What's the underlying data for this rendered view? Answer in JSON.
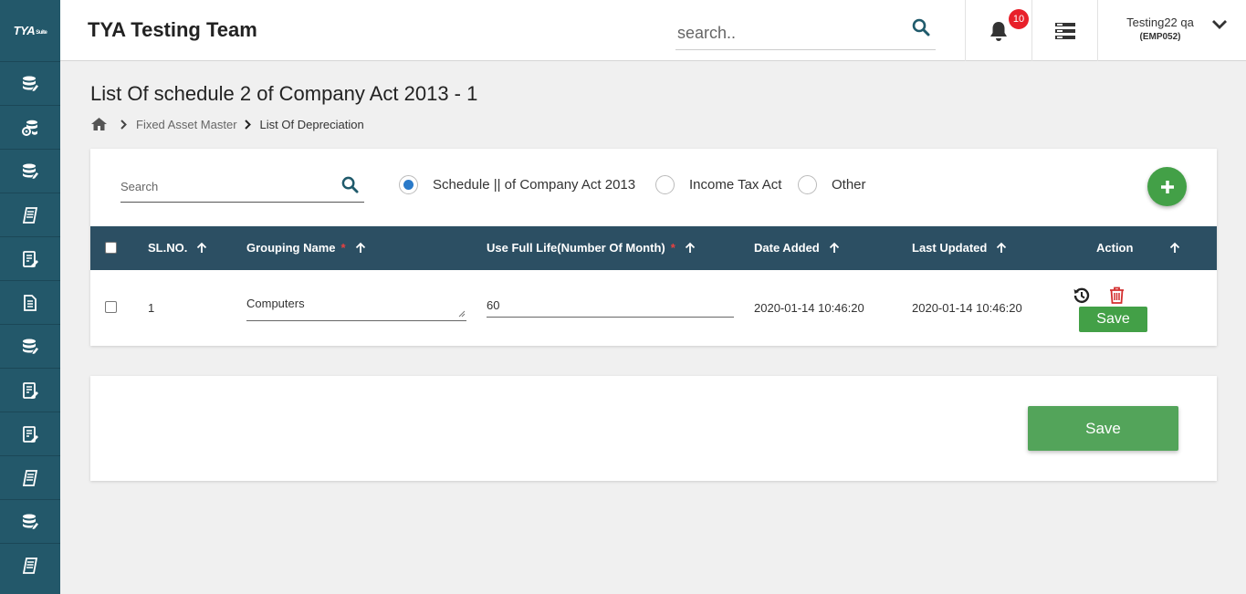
{
  "brand": {
    "logo_text": "TYA",
    "logo_sub": "Suite"
  },
  "header": {
    "title": "TYA Testing Team",
    "search_placeholder": "search..",
    "notification_count": "10",
    "user_name": "Testing22 qa",
    "user_code": "(EMP052)"
  },
  "sidebar": {
    "items": [
      {
        "icon": "database-icon"
      },
      {
        "icon": "gear-database-icon"
      },
      {
        "icon": "database-icon"
      },
      {
        "icon": "ledger-icon"
      },
      {
        "icon": "edit-document-icon"
      },
      {
        "icon": "document-icon"
      },
      {
        "icon": "database-icon"
      },
      {
        "icon": "edit-document-icon"
      },
      {
        "icon": "edit-document-icon"
      },
      {
        "icon": "ledger-icon"
      },
      {
        "icon": "database-icon"
      },
      {
        "icon": "ledger-icon"
      }
    ]
  },
  "page": {
    "title": "List Of schedule 2 of Company Act 2013 - 1",
    "breadcrumb": [
      "Fixed Asset Master",
      "List Of Depreciation"
    ]
  },
  "filters": {
    "search_placeholder": "Search",
    "radios": [
      {
        "label": "Schedule || of Company Act 2013",
        "selected": true
      },
      {
        "label": "Income Tax Act",
        "selected": false
      },
      {
        "label": "Other",
        "selected": false
      }
    ]
  },
  "table": {
    "columns": {
      "sl_no": "SL.NO.",
      "grouping_name": "Grouping Name",
      "useful_life": "Use Full Life(Number Of Month)",
      "date_added": "Date Added",
      "last_updated": "Last Updated",
      "action": "Action"
    },
    "required_mark": "*",
    "rows": [
      {
        "sl_no": "1",
        "grouping_name": "Computers",
        "useful_life": "60",
        "date_added": "2020-01-14 10:46:20",
        "last_updated": "2020-01-14 10:46:20",
        "save_label": "Save"
      }
    ]
  },
  "footer": {
    "save_label": "Save"
  },
  "colors": {
    "sidebar": "#23586a",
    "table_header": "#2c4f63",
    "accent_green": "#43a047",
    "badge_red": "#e8202a",
    "delete_red": "#d32f2f",
    "radio_blue": "#2a7ac9"
  }
}
